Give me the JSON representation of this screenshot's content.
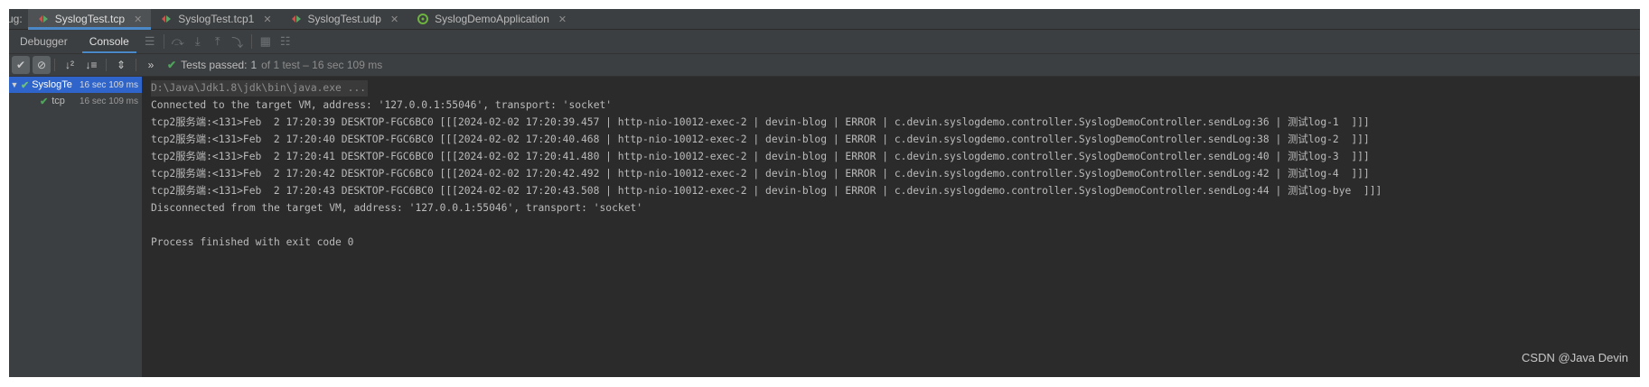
{
  "debug_label": "ug:",
  "tabs": [
    {
      "label": "SyslogTest.tcp",
      "active": true
    },
    {
      "label": "SyslogTest.tcp1",
      "active": false
    },
    {
      "label": "SyslogTest.udp",
      "active": false
    },
    {
      "label": "SyslogDemoApplication",
      "active": false
    }
  ],
  "subtabs": {
    "debugger": "Debugger",
    "console": "Console"
  },
  "test_status": {
    "prefix": "Tests passed:",
    "count": "1",
    "suffix": "of 1 test – 16 sec 109 ms"
  },
  "tree": [
    {
      "label": "SyslogTe",
      "time": "16 sec 109 ms"
    },
    {
      "label": "tcp",
      "time": "16 sec 109 ms"
    }
  ],
  "console": {
    "command": "D:\\Java\\Jdk1.8\\jdk\\bin\\java.exe ...",
    "connected": "Connected to the target VM, address: '127.0.0.1:55046', transport: 'socket'",
    "logs": [
      "tcp2服务端:<131>Feb  2 17:20:39 DESKTOP-FGC6BC0 [[[2024-02-02 17:20:39.457 | http-nio-10012-exec-2 | devin-blog | ERROR | c.devin.syslogdemo.controller.SyslogDemoController.sendLog:36 | 测试log-1  ]]]",
      "tcp2服务端:<131>Feb  2 17:20:40 DESKTOP-FGC6BC0 [[[2024-02-02 17:20:40.468 | http-nio-10012-exec-2 | devin-blog | ERROR | c.devin.syslogdemo.controller.SyslogDemoController.sendLog:38 | 测试log-2  ]]]",
      "tcp2服务端:<131>Feb  2 17:20:41 DESKTOP-FGC6BC0 [[[2024-02-02 17:20:41.480 | http-nio-10012-exec-2 | devin-blog | ERROR | c.devin.syslogdemo.controller.SyslogDemoController.sendLog:40 | 测试log-3  ]]]",
      "tcp2服务端:<131>Feb  2 17:20:42 DESKTOP-FGC6BC0 [[[2024-02-02 17:20:42.492 | http-nio-10012-exec-2 | devin-blog | ERROR | c.devin.syslogdemo.controller.SyslogDemoController.sendLog:42 | 测试log-4  ]]]",
      "tcp2服务端:<131>Feb  2 17:20:43 DESKTOP-FGC6BC0 [[[2024-02-02 17:20:43.508 | http-nio-10012-exec-2 | devin-blog | ERROR | c.devin.syslogdemo.controller.SyslogDemoController.sendLog:44 | 测试log-bye  ]]]"
    ],
    "disconnected": "Disconnected from the target VM, address: '127.0.0.1:55046', transport: 'socket'",
    "exit": "Process finished with exit code 0"
  },
  "watermark": "CSDN @Java Devin",
  "colors": {
    "accent": "#4a88c7",
    "pass": "#4fa35b",
    "selection": "#2f65ca"
  }
}
